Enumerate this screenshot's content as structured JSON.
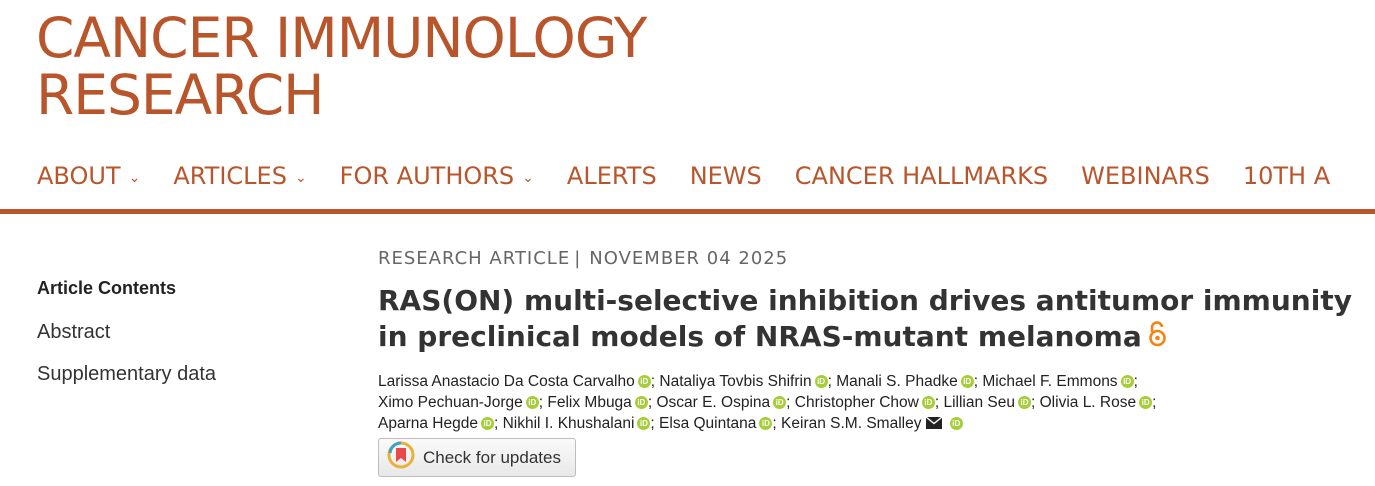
{
  "journal": {
    "line1": "CANCER IMMUNOLOGY",
    "line2": "RESEARCH"
  },
  "nav": {
    "items": [
      {
        "label": "ABOUT",
        "dropdown": true
      },
      {
        "label": "ARTICLES",
        "dropdown": true
      },
      {
        "label": "FOR AUTHORS",
        "dropdown": true
      },
      {
        "label": "ALERTS",
        "dropdown": false
      },
      {
        "label": "NEWS",
        "dropdown": false
      },
      {
        "label": "CANCER HALLMARKS",
        "dropdown": false
      },
      {
        "label": "WEBINARS",
        "dropdown": false
      },
      {
        "label": "10TH A",
        "dropdown": false
      }
    ],
    "chevron": "⌄"
  },
  "sidebar": {
    "title": "Article Contents",
    "links": [
      "Abstract",
      "Supplementary data"
    ]
  },
  "article": {
    "type": "RESEARCH ARTICLE",
    "separator": "|",
    "date": "NOVEMBER 04 2025",
    "title": "RAS(ON) multi-selective inhibition drives antitumor immunity in preclinical models of NRAS-mutant melanoma",
    "open_access_icon": "open-access-lock-icon"
  },
  "authors": {
    "orcid_label": "iD",
    "list": [
      "Larissa Anastacio Da Costa Carvalho",
      "Nataliya Tovbis Shifrin",
      "Manali S. Phadke",
      "Michael F. Emmons",
      "Ximo Pechuan-Jorge",
      "Felix Mbuga",
      "Oscar E. Ospina",
      "Christopher Chow",
      "Lillian Seu",
      "Olivia L. Rose",
      "Aparna Hegde",
      "Nikhil I. Khushalani",
      "Elsa Quintana",
      "Keiran S.M. Smalley"
    ]
  },
  "check_updates": {
    "label": "Check for updates"
  },
  "colors": {
    "brand": "#b9552b",
    "orcid": "#a6ce39",
    "open_access": "#f68212"
  }
}
